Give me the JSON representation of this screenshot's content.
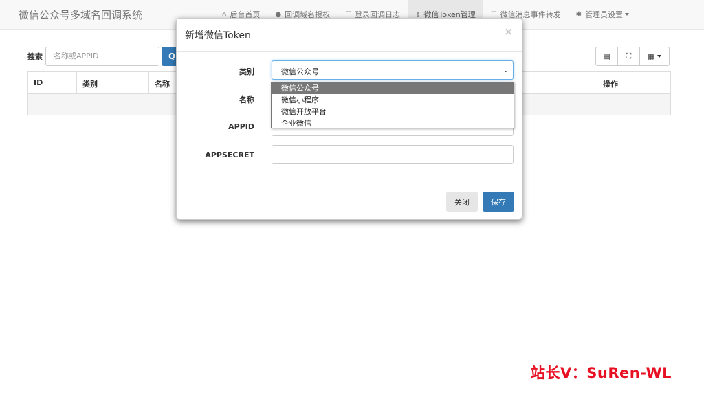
{
  "brand": "微信公众号多域名回调系统",
  "nav": {
    "items": [
      {
        "icon": "home-icon",
        "glyph": "⌂",
        "label": "后台首页",
        "active": false
      },
      {
        "icon": "globe-icon",
        "glyph": "●",
        "label": "回调域名授权",
        "active": false
      },
      {
        "icon": "list-icon",
        "glyph": "☰",
        "label": "登录回调日志",
        "active": false
      },
      {
        "icon": "key-icon",
        "glyph": "⚷",
        "label": "微信Token管理",
        "active": true
      },
      {
        "icon": "tasks-icon",
        "glyph": "☷",
        "label": "微信消息事件转发",
        "active": false
      },
      {
        "icon": "cog-icon",
        "glyph": "✱",
        "label": "管理员设置",
        "active": false
      }
    ]
  },
  "toolbar": {
    "search_label": "搜索",
    "search_placeholder": "名称或APPID",
    "search_button_glyph": "Q",
    "tools": [
      {
        "icon": "list-view-icon",
        "glyph": "▤"
      },
      {
        "icon": "fullscreen-icon",
        "glyph": "⛶"
      },
      {
        "icon": "columns-icon",
        "glyph": "▦"
      }
    ]
  },
  "table": {
    "columns": [
      "ID",
      "类别",
      "名称",
      "操作"
    ]
  },
  "modal": {
    "title": "新增微信Token",
    "close_glyph": "×",
    "fields": {
      "type_label": "类别",
      "type_value": "微信公众号",
      "name_label": "名称",
      "name_value": "",
      "appid_label": "APPID",
      "appid_value": "",
      "appsecret_label": "APPSECRET",
      "appsecret_value": ""
    },
    "type_options": [
      "微信公众号",
      "微信小程序",
      "微信开放平台",
      "企业微信"
    ],
    "selected_option": "微信公众号",
    "close_button": "关闭",
    "save_button": "保存"
  },
  "watermark": "站长V：SuRen-WL",
  "colors": {
    "primary": "#337ab7",
    "watermark": "#e81123"
  }
}
